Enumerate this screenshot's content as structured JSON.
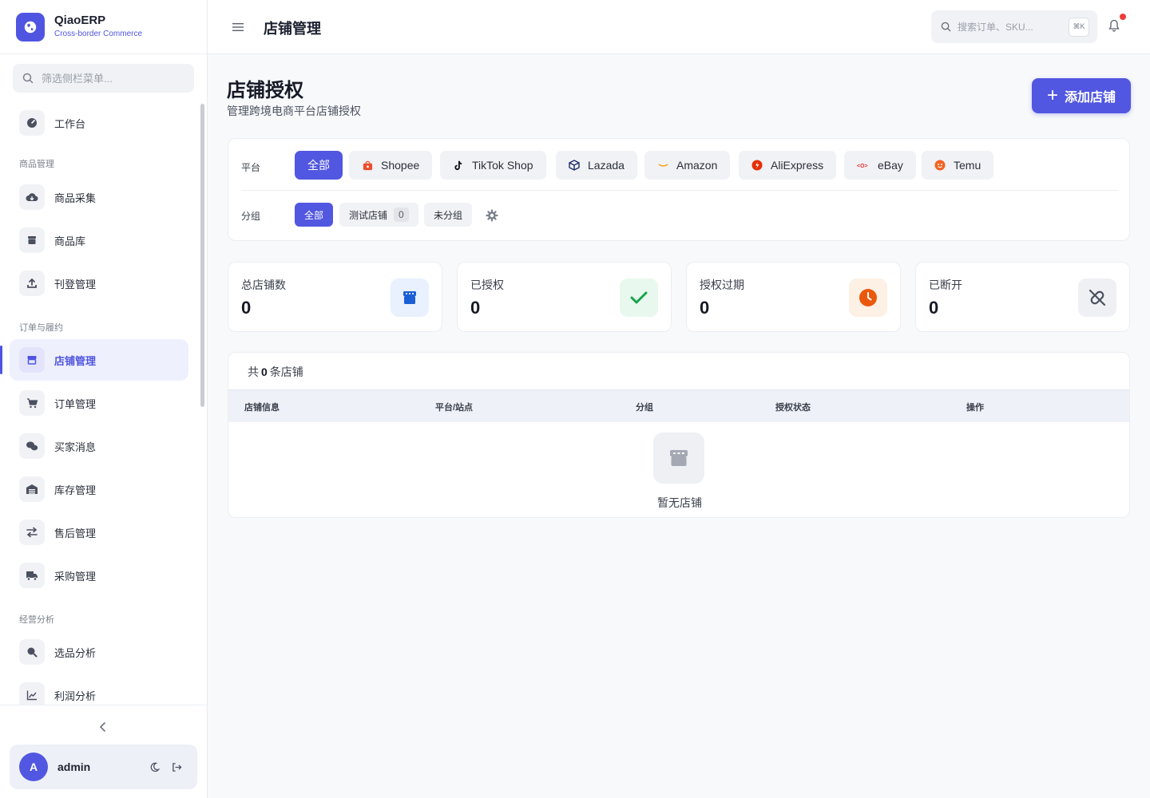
{
  "brand": {
    "name": "QiaoERP",
    "subtitle": "Cross-border Commerce"
  },
  "sidebar": {
    "search_placeholder": "筛选侧栏菜单...",
    "sections": {
      "products": "商品管理",
      "orders": "订单与履约",
      "analytics": "经营分析"
    },
    "items": [
      {
        "label": "工作台",
        "icon": "dashboard-icon"
      },
      {
        "label": "商品采集",
        "icon": "cloud-download-icon"
      },
      {
        "label": "商品库",
        "icon": "box-icon"
      },
      {
        "label": "刊登管理",
        "icon": "upload-icon"
      },
      {
        "label": "店铺管理",
        "icon": "store-icon",
        "active": true
      },
      {
        "label": "订单管理",
        "icon": "cart-icon"
      },
      {
        "label": "买家消息",
        "icon": "chat-icon"
      },
      {
        "label": "库存管理",
        "icon": "warehouse-icon"
      },
      {
        "label": "售后管理",
        "icon": "exchange-icon"
      },
      {
        "label": "采购管理",
        "icon": "truck-icon"
      },
      {
        "label": "选品分析",
        "icon": "search-analytics-icon"
      },
      {
        "label": "利润分析",
        "icon": "line-chart-icon"
      }
    ],
    "user": {
      "initial": "A",
      "name": "admin"
    }
  },
  "header": {
    "title": "店铺管理",
    "search_placeholder": "搜索订单、SKU...",
    "shortcut": "⌘K"
  },
  "page": {
    "title": "店铺授权",
    "subtitle": "管理跨境电商平台店铺授权",
    "add_button": "添加店铺"
  },
  "filters": {
    "platform_label": "平台",
    "platforms": [
      "全部",
      "Shopee",
      "TikTok Shop",
      "Lazada",
      "Amazon",
      "AliExpress",
      "eBay",
      "Temu"
    ],
    "group_label": "分组",
    "groups": {
      "all": "全部",
      "test": "测试店铺",
      "test_count": "0",
      "ungrouped": "未分组"
    }
  },
  "stats": [
    {
      "label": "总店铺数",
      "value": "0",
      "color": "#1a5fd6",
      "bg": "#e8f1fd"
    },
    {
      "label": "已授权",
      "value": "0",
      "color": "#17a34a",
      "bg": "#e9f8ee"
    },
    {
      "label": "授权过期",
      "value": "0",
      "color": "#ea580c",
      "bg": "#fdf0e4"
    },
    {
      "label": "已断开",
      "value": "0",
      "color": "#4a5060",
      "bg": "#eff0f3"
    }
  ],
  "table": {
    "count_prefix": "共",
    "count": "0",
    "count_suffix": "条店铺",
    "columns": [
      "店铺信息",
      "平台/站点",
      "分组",
      "授权状态",
      "操作"
    ],
    "empty_text": "暂无店铺"
  },
  "colors": {
    "accent": "#5157e0"
  }
}
